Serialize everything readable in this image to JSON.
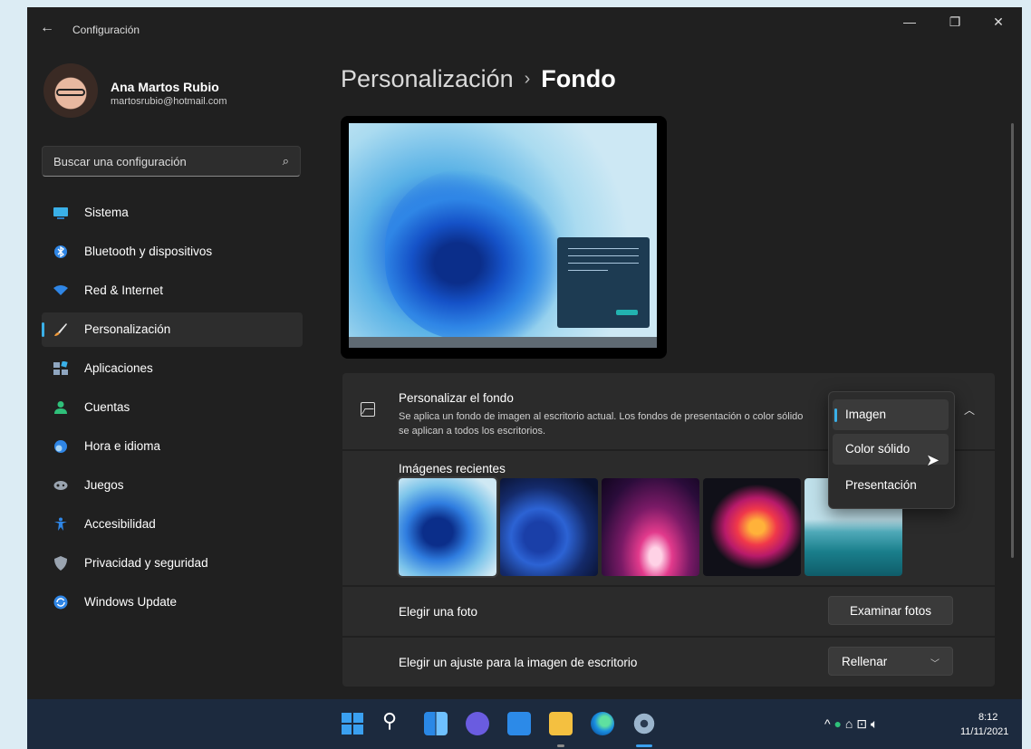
{
  "window": {
    "app_title": "Configuración",
    "minimize_glyph": "—",
    "maximize_glyph": "❐",
    "close_glyph": "✕",
    "back_glyph": "←"
  },
  "profile": {
    "name": "Ana Martos Rubio",
    "email": "martosrubio@hotmail.com"
  },
  "search": {
    "placeholder": "Buscar una configuración"
  },
  "sidebar": {
    "items": [
      {
        "label": "Sistema",
        "icon": "monitor-icon",
        "color": "#3ab0e8"
      },
      {
        "label": "Bluetooth y dispositivos",
        "icon": "bluetooth-icon",
        "color": "#2f86e6"
      },
      {
        "label": "Red & Internet",
        "icon": "wifi-icon",
        "color": "#2f86e6"
      },
      {
        "label": "Personalización",
        "icon": "brush-icon",
        "color": "#f09a3a"
      },
      {
        "label": "Aplicaciones",
        "icon": "apps-icon",
        "color": "#8fa6c0"
      },
      {
        "label": "Cuentas",
        "icon": "person-icon",
        "color": "#2fc07a"
      },
      {
        "label": "Hora e idioma",
        "icon": "globe-clock-icon",
        "color": "#2f86e6"
      },
      {
        "label": "Juegos",
        "icon": "gamepad-icon",
        "color": "#9aa4b0"
      },
      {
        "label": "Accesibilidad",
        "icon": "accessibility-icon",
        "color": "#2f86e6"
      },
      {
        "label": "Privacidad y seguridad",
        "icon": "shield-icon",
        "color": "#9aa4b0"
      },
      {
        "label": "Windows Update",
        "icon": "update-icon",
        "color": "#2f86e6"
      }
    ],
    "active_index": 3
  },
  "breadcrumb": {
    "parent": "Personalización",
    "separator": "›",
    "current": "Fondo"
  },
  "personalize": {
    "title": "Personalizar el fondo",
    "description": "Se aplica un fondo de imagen al escritorio actual. Los fondos de presentación o color sólido se aplican a todos los escritorios.",
    "options": [
      "Imagen",
      "Color sólido",
      "Presentación"
    ],
    "selected": "Imagen",
    "hovered": "Color sólido"
  },
  "recent": {
    "label": "Imágenes recientes"
  },
  "photo": {
    "label": "Elegir una foto",
    "button": "Examinar fotos"
  },
  "fit": {
    "label": "Elegir un ajuste para la imagen de escritorio",
    "value": "Rellenar"
  },
  "taskbar": {
    "time": "8:12",
    "date": "11/11/2021",
    "tray_glyphs": "^",
    "accent": "#3aa0f0"
  }
}
